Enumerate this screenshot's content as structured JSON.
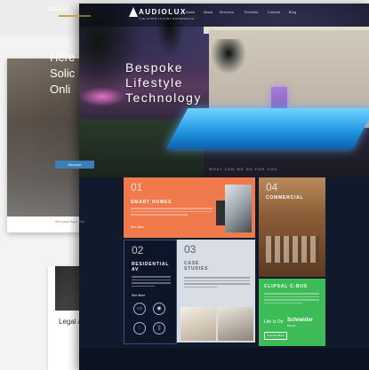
{
  "back_site": {
    "logo": "SOLIC",
    "headline": [
      "Here",
      "Solic",
      "Onli"
    ],
    "cta": "Discover",
    "note": "We have legal Mid"
  },
  "bottom_card": {
    "title": "Legal Ai CPD"
  },
  "main_site": {
    "logo": "AUDIOLUX",
    "logo_sub": "THE AUDIO LUXURY EXPERIENCE",
    "nav": [
      "Home",
      "About",
      "Services",
      "Portfolio",
      "Contact",
      "Blog"
    ],
    "hero_title": [
      "Bespoke",
      "Lifestyle",
      "Technology"
    ],
    "hero_caption": "WHAT CAN WE DO FOR YOU",
    "tiles": {
      "smart": {
        "num": "01",
        "title": "SMART HOMES",
        "link": "See More"
      },
      "commercial": {
        "num": "04",
        "title": "COMMERCIAL"
      },
      "residential": {
        "num": "02",
        "title": "RESIDENTIAL AV",
        "link": "See More"
      },
      "case": {
        "num": "03",
        "title": "CASE STUDIES"
      },
      "clipsal": {
        "title": "CLIPSAL C-BUS",
        "lifeison": "Life Is On",
        "brand": "Schneider",
        "brand_sub": "Electric",
        "button": "Find Out More"
      }
    }
  }
}
